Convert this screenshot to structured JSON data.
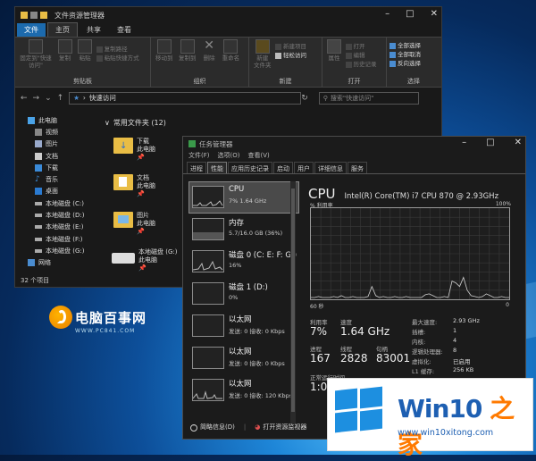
{
  "explorer": {
    "title": "文件资源管理器",
    "tabs": [
      "文件",
      "主页",
      "共享",
      "查看"
    ],
    "ribbon": {
      "clipboard": {
        "name": "剪贴板",
        "pin": "固定到\"快速访问\"",
        "copy": "复制",
        "paste": "粘贴",
        "cut": "复制路径",
        "paste_shortcut": "粘贴快捷方式"
      },
      "organize": {
        "name": "组织",
        "move": "移动到",
        "copyto": "复制到",
        "delete": "删除",
        "rename": "重命名"
      },
      "new": {
        "name": "新建",
        "folder": "新建\n文件夹",
        "item": "新建项目",
        "easy": "轻松访问"
      },
      "open": {
        "name": "打开",
        "props": "属性",
        "open": "打开",
        "edit": "编辑",
        "history": "历史记录"
      },
      "select": {
        "name": "选择",
        "all": "全部选择",
        "none": "全部取消",
        "invert": "反向选择"
      }
    },
    "address": "快速访问",
    "search_placeholder": "搜索\"快速访问\"",
    "nav": [
      "此电脑",
      "视频",
      "图片",
      "文档",
      "下载",
      "音乐",
      "桌面",
      "本地磁盘 (C:)",
      "本地磁盘 (D:)",
      "本地磁盘 (E:)",
      "本地磁盘 (F:)",
      "本地磁盘 (G:)",
      "网络"
    ],
    "section": "常用文件夹 (12)",
    "items": [
      {
        "name": "下载",
        "sub": "此电脑"
      },
      {
        "name": "文档",
        "sub": "此电脑"
      },
      {
        "name": "图片",
        "sub": "此电脑"
      },
      {
        "name": "本地磁盘 (G:)",
        "sub": "此电脑"
      }
    ],
    "status": "32 个项目"
  },
  "logo": {
    "text": "电脑百事网",
    "sub": "WWW.PC841.COM"
  },
  "taskmgr": {
    "title": "任务管理器",
    "menu": [
      "文件(F)",
      "选项(O)",
      "查看(V)"
    ],
    "tabs": [
      "进程",
      "性能",
      "应用历史记录",
      "启动",
      "用户",
      "详细信息",
      "服务"
    ],
    "side": [
      {
        "name": "CPU",
        "sub": "7% 1.64 GHz"
      },
      {
        "name": "内存",
        "sub": "5.7/16.0 GB (36%)"
      },
      {
        "name": "磁盘 0 (C: E: F: G:)",
        "sub": "16%"
      },
      {
        "name": "磁盘 1 (D:)",
        "sub": "0%"
      },
      {
        "name": "以太网",
        "sub": "发送: 0 接收: 0 Kbps"
      },
      {
        "name": "以太网",
        "sub": "发送: 0 接收: 0 Kbps"
      },
      {
        "name": "以太网",
        "sub": "发送: 0 接收: 120 Kbps"
      }
    ],
    "cpu": {
      "heading": "CPU",
      "model": "Intel(R) Core(TM) i7 CPU 870 @ 2.93GHz",
      "util_label": "% 利用率",
      "max_label": "100%",
      "time_label": "60 秒",
      "zero_label": "0",
      "stats": {
        "util_l": "利用率",
        "util": "7%",
        "speed_l": "速度",
        "speed": "1.64 GHz",
        "proc_l": "进程",
        "proc": "167",
        "thr_l": "线程",
        "thr": "2828",
        "hnd_l": "句柄",
        "hnd": "83001",
        "up_l": "正常运行时间",
        "up": "1:0"
      },
      "info": [
        [
          "最大速度:",
          "2.93 GHz"
        ],
        [
          "插槽:",
          "1"
        ],
        [
          "内核:",
          "4"
        ],
        [
          "逻辑处理器:",
          "8"
        ],
        [
          "虚拟化:",
          "已启用"
        ],
        [
          "L1 缓存:",
          "256 KB"
        ]
      ],
      "graph": [
        2,
        2,
        3,
        2,
        2,
        2,
        3,
        2,
        4,
        2,
        2,
        3,
        2,
        2,
        2,
        3,
        14,
        4,
        2,
        3,
        2,
        2,
        3,
        2,
        2,
        3,
        2,
        2,
        2,
        2,
        5,
        6,
        4,
        2,
        2,
        3,
        2,
        20,
        18,
        14,
        24,
        10,
        4,
        3,
        2,
        3,
        6,
        4,
        2,
        2,
        3,
        2,
        2
      ]
    },
    "footer": {
      "less": "简略信息(D)",
      "monitor": "打开资源监视器"
    }
  },
  "badge": {
    "win": "Win10",
    "zhi": " 之家",
    "url": "www.win10xitong.com"
  },
  "colors": {
    "accent": "#1d8fe0",
    "brand_orange": "#ff7a00"
  }
}
